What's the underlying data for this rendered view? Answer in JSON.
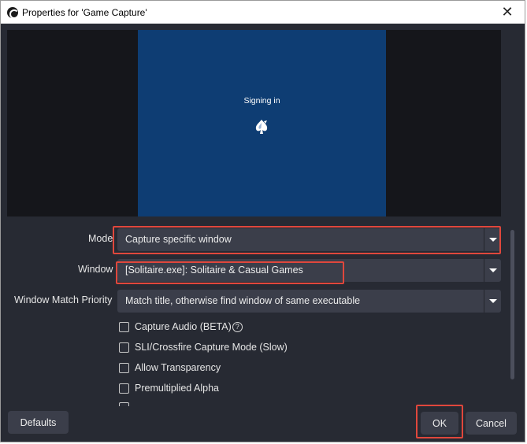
{
  "window": {
    "title": "Properties for 'Game Capture'"
  },
  "preview": {
    "status_text": "Signing in"
  },
  "form": {
    "mode": {
      "label": "Mode",
      "value": "Capture specific window"
    },
    "window": {
      "label": "Window",
      "value": "[Solitaire.exe]: Solitaire & Casual Games"
    },
    "priority": {
      "label": "Window Match Priority",
      "value": "Match title, otherwise find window of same executable"
    },
    "checkboxes": [
      {
        "label": "Capture Audio (BETA)",
        "checked": false
      },
      {
        "label": "SLI/Crossfire Capture Mode (Slow)",
        "checked": false
      },
      {
        "label": "Allow Transparency",
        "checked": false
      },
      {
        "label": "Premultiplied Alpha",
        "checked": false
      },
      {
        "label": "",
        "checked": false
      }
    ]
  },
  "buttons": {
    "defaults": "Defaults",
    "ok": "OK",
    "cancel": "Cancel"
  },
  "colors": {
    "dialog_bg": "#272a33",
    "preview_blue": "#0e3d73",
    "control_bg": "#3b3e4a",
    "highlight_red": "#e0473c"
  }
}
